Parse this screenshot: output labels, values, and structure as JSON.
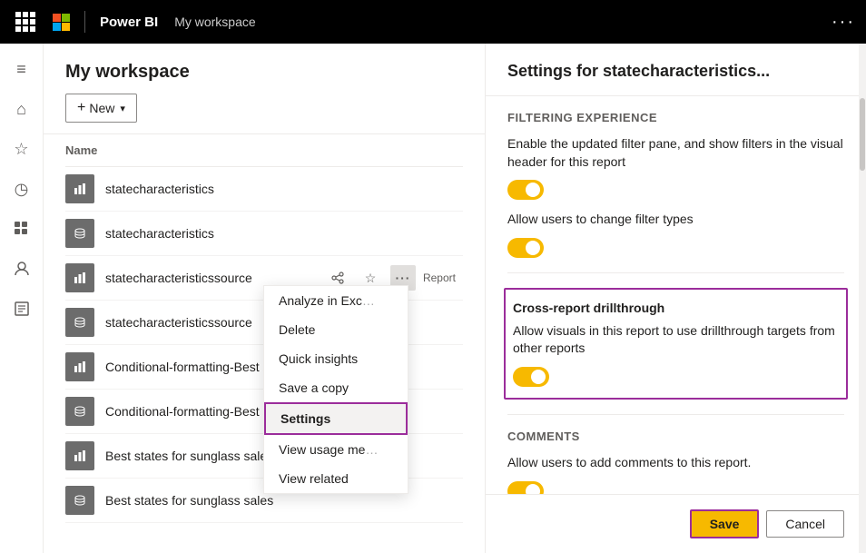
{
  "topnav": {
    "app_name": "Power BI",
    "workspace": "My workspace",
    "more_icon": "···"
  },
  "sidebar": {
    "items": [
      {
        "id": "home",
        "icon": "⌂",
        "label": "Home"
      },
      {
        "id": "favorites",
        "icon": "☆",
        "label": "Favorites"
      },
      {
        "id": "recent",
        "icon": "○",
        "label": "Recent"
      },
      {
        "id": "apps",
        "icon": "⊞",
        "label": "Apps"
      },
      {
        "id": "shared",
        "icon": "👤",
        "label": "Shared with me"
      },
      {
        "id": "learn",
        "icon": "□",
        "label": "Learn"
      }
    ]
  },
  "workspace": {
    "title": "My workspace",
    "new_button": "New",
    "table": {
      "header": "Name",
      "rows": [
        {
          "id": 1,
          "type": "chart",
          "name": "statecharacteristics",
          "badge": ""
        },
        {
          "id": 2,
          "type": "db",
          "name": "statecharacteristics",
          "badge": ""
        },
        {
          "id": 3,
          "type": "chart",
          "name": "statecharacteristicssource",
          "badge": "Report",
          "active": true
        },
        {
          "id": 4,
          "type": "db",
          "name": "statecharacteristicssource",
          "badge": ""
        },
        {
          "id": 5,
          "type": "chart",
          "name": "Conditional-formatting-Best states for sunglass sales",
          "badge": ""
        },
        {
          "id": 6,
          "type": "db",
          "name": "Conditional-formatting-Best states for sunglass sales",
          "badge": ""
        },
        {
          "id": 7,
          "type": "chart",
          "name": "Best states for sunglass sales",
          "badge": ""
        },
        {
          "id": 8,
          "type": "db",
          "name": "Best states for sunglass sales",
          "badge": ""
        }
      ]
    }
  },
  "context_menu": {
    "items": [
      {
        "id": "analyze",
        "label": "Analyze in Exc",
        "truncated": true,
        "active": false
      },
      {
        "id": "delete",
        "label": "Delete",
        "active": false
      },
      {
        "id": "quick-insights",
        "label": "Quick insights",
        "active": false
      },
      {
        "id": "save-copy",
        "label": "Save a copy",
        "active": false
      },
      {
        "id": "settings",
        "label": "Settings",
        "active": true
      },
      {
        "id": "view-usage",
        "label": "View usage me",
        "truncated": true,
        "active": false
      },
      {
        "id": "view-related",
        "label": "View related",
        "active": false
      }
    ]
  },
  "settings": {
    "title": "Settings for statecharacteristics...",
    "sections": {
      "filtering": {
        "label": "Filtering experience",
        "desc1": "Enable the updated filter pane, and show filters in the visual header for this report",
        "toggle1": true,
        "desc2": "Allow users to change filter types",
        "toggle2": true
      },
      "drillthrough": {
        "label": "Cross-report drillthrough",
        "desc": "Allow visuals in this report to use drillthrough targets from other reports",
        "toggle": true,
        "highlighted": true
      },
      "comments": {
        "label": "Comments",
        "desc": "Allow users to add comments to this report.",
        "toggle": true
      }
    },
    "footer": {
      "save_label": "Save",
      "cancel_label": "Cancel"
    }
  }
}
